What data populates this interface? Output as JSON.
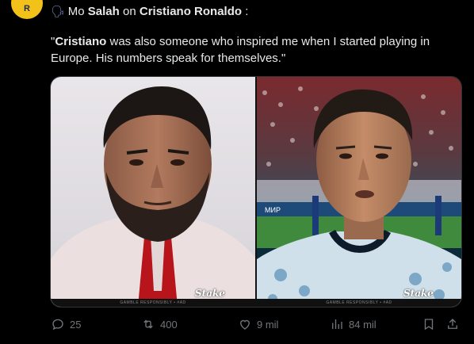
{
  "author": {
    "avatar_text": "R",
    "speaker_emoji": "🗣"
  },
  "post": {
    "header_prefix": "Mo ",
    "header_subject": "Salah",
    "header_middle": " on ",
    "header_object": "Cristiano Ronaldo",
    "header_suffix": " :",
    "quote_open": "\"",
    "quote_name": "Cristiano",
    "quote_rest": " was also someone who inspired me when I started playing in Europe. His numbers speak for themselves.\""
  },
  "media": {
    "left_watermark": "Stake",
    "right_watermark": "Stake",
    "left_caption": "GAMBLE RESPONSIBLY • #AD",
    "right_caption": "GAMBLE RESPONSIBLY • #AD",
    "board_text": "МИР"
  },
  "actions": {
    "replies": "25",
    "reposts": "400",
    "likes": "9 mil",
    "views": "84 mil"
  },
  "colors": {
    "background": "#000000",
    "text": "#e7e9ea",
    "muted": "#71767b",
    "avatar": "#f2c21b"
  }
}
